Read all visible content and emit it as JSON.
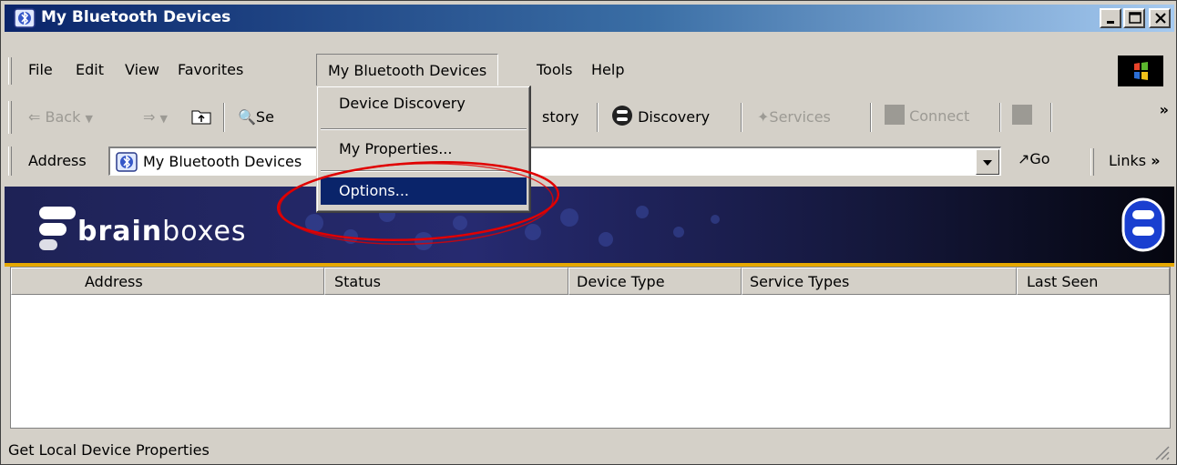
{
  "window": {
    "title": "My Bluetooth Devices",
    "title_icon": "bluetooth-folder-icon"
  },
  "menubar": {
    "items": [
      "File",
      "Edit",
      "View",
      "Favorites",
      "My Bluetooth Devices",
      "Tools",
      "Help"
    ],
    "active_item": "My Bluetooth Devices"
  },
  "dropdown": {
    "items": [
      "Device Discovery",
      "My Properties...",
      "Options..."
    ],
    "highlighted": "Options..."
  },
  "toolbar": {
    "back": "Back",
    "search_partial": "Se",
    "history_partial": "story",
    "discovery": "Discovery",
    "services": "Services",
    "connect": "Connect",
    "more": "»"
  },
  "addressbar": {
    "label": "Address",
    "value": "My Bluetooth Devices",
    "go": "Go",
    "links": "Links",
    "links_more": "»"
  },
  "banner": {
    "brand_bold": "brain",
    "brand_light": "boxes"
  },
  "listview": {
    "columns": [
      "Address",
      "Status",
      "Device Type",
      "Service Types",
      "Last Seen"
    ]
  },
  "statusbar": {
    "text": "Get Local Device Properties"
  },
  "colors": {
    "title_start": "#0a246a",
    "title_end": "#a6caf0",
    "highlight": "#0a246a",
    "banner_accent": "#e6a800",
    "annotation": "#e00000"
  }
}
